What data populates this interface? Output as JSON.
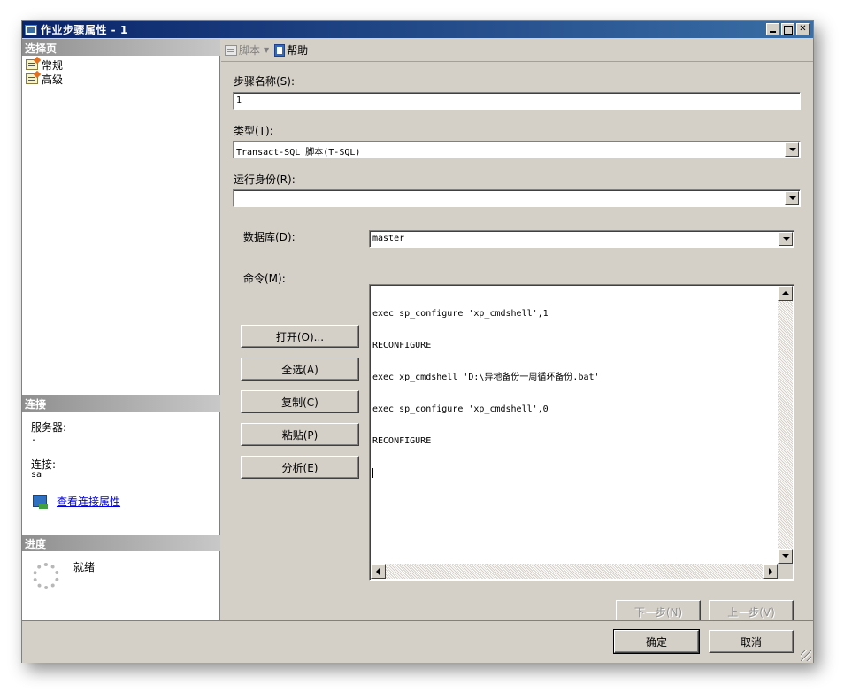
{
  "window": {
    "title": "作业步骤属性 - 1"
  },
  "left_panel": {
    "select_page_header": "选择页",
    "pages": [
      {
        "label": "常规"
      },
      {
        "label": "高级"
      }
    ],
    "connection_header": "连接",
    "server_label": "服务器:",
    "server_value": ".",
    "connection_label": "连接:",
    "connection_value": "sa",
    "view_connection_link": "查看连接属性",
    "progress_header": "进度",
    "progress_status": "就绪"
  },
  "toolbar": {
    "script_label": "脚本",
    "help_label": "帮助"
  },
  "form": {
    "step_name_label": "步骤名称(S):",
    "step_name_value": "1",
    "type_label": "类型(T):",
    "type_value": "Transact-SQL 脚本(T-SQL)",
    "run_as_label": "运行身份(R):",
    "run_as_value": "",
    "database_label": "数据库(D):",
    "database_value": "master",
    "command_label": "命令(M):",
    "command_lines": [
      "exec sp_configure 'xp_cmdshell',1",
      "RECONFIGURE",
      "exec xp_cmdshell 'D:\\异地备份一周循环备份.bat'",
      "exec sp_configure 'xp_cmdshell',0",
      "RECONFIGURE"
    ]
  },
  "buttons": {
    "open": "打开(O)...",
    "select_all": "全选(A)",
    "copy": "复制(C)",
    "paste": "粘贴(P)",
    "parse": "分析(E)",
    "next": "下一步(N)",
    "previous": "上一步(V)",
    "ok": "确定",
    "cancel": "取消"
  }
}
